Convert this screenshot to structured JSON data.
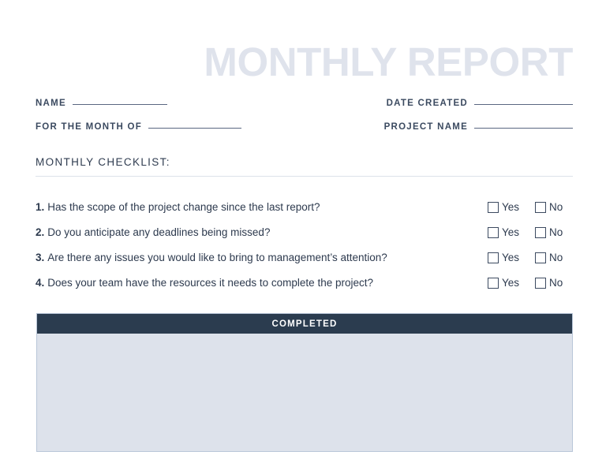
{
  "document": {
    "title": "MONTHLY REPORT"
  },
  "header_fields": {
    "rows": [
      {
        "left_label": "NAME",
        "left_value": "",
        "right_label": "DATE CREATED",
        "right_value": ""
      },
      {
        "left_label": "FOR THE MONTH OF",
        "left_value": "",
        "right_label": "PROJECT NAME",
        "right_value": ""
      }
    ]
  },
  "checklist": {
    "heading": "MONTHLY CHECKLIST:",
    "yes_label": "Yes",
    "no_label": "No",
    "items": [
      {
        "number": "1.",
        "question": "Has the scope of the project change since the last report?",
        "yes_checked": false,
        "no_checked": false
      },
      {
        "number": "2.",
        "question": "Do you anticipate any deadlines being missed?",
        "yes_checked": false,
        "no_checked": false
      },
      {
        "number": "3.",
        "question": "Are there any issues you would like to bring to management’s attention?",
        "yes_checked": false,
        "no_checked": false
      },
      {
        "number": "4.",
        "question": "Does your team have the resources it needs to complete the project?",
        "yes_checked": false,
        "no_checked": false
      }
    ]
  },
  "completed_section": {
    "header": "COMPLETED",
    "body_text": ""
  },
  "colors": {
    "title": "#dfe3ec",
    "text": "#2d3a4e",
    "label": "#3b4a60",
    "rule": "#5a6781",
    "divider": "#dde2ea",
    "bar_background": "#2b3c4f",
    "bar_text": "#ffffff",
    "panel_background": "#dde2eb",
    "panel_border": "#b9c6d8",
    "page_background": "#ffffff"
  }
}
